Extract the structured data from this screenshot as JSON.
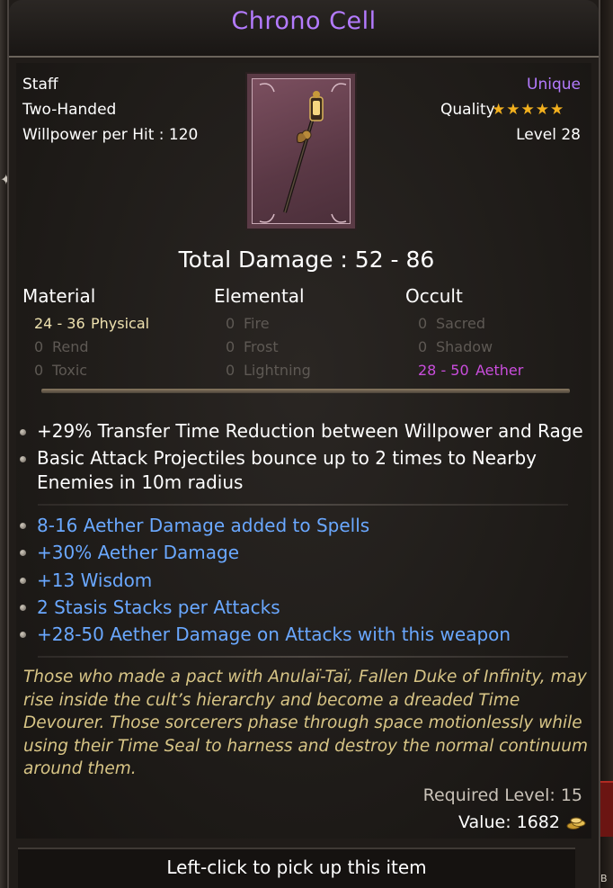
{
  "item": {
    "name": "Chrono Cell",
    "type": "Staff",
    "handedness": "Two-Handed",
    "willpower_per_hit": "Willpower per Hit : 120",
    "rarity": "Unique",
    "quality_label": "Quality",
    "quality_stars": 5,
    "level": "Level 28"
  },
  "damage": {
    "total": "Total Damage : 52 - 86",
    "columns": {
      "material": "Material",
      "elemental": "Elemental",
      "occult": "Occult"
    },
    "material": [
      {
        "value": "24 - 36",
        "label": "Physical"
      },
      {
        "value": "0",
        "label": "Rend"
      },
      {
        "value": "0",
        "label": "Toxic"
      }
    ],
    "elemental": [
      {
        "value": "0",
        "label": "Fire"
      },
      {
        "value": "0",
        "label": "Frost"
      },
      {
        "value": "0",
        "label": "Lightning"
      }
    ],
    "occult": [
      {
        "value": "0",
        "label": "Sacred"
      },
      {
        "value": "0",
        "label": "Shadow"
      },
      {
        "value": "28 - 50",
        "label": "Aether"
      }
    ]
  },
  "implicit_affixes": [
    "+29% Transfer Time Reduction between Willpower and Rage",
    "Basic Attack Projectiles bounce up to 2 times to Nearby",
    "Enemies in 10m radius"
  ],
  "affixes": [
    "8-16 Aether Damage added to Spells",
    "+30% Aether Damage",
    "+13 Wisdom",
    "2 Stasis Stacks per Attacks",
    "+28-50 Aether Damage on Attacks with this weapon"
  ],
  "lore": [
    "Those who made a pact with Anulaï-Taï, Fallen Duke of Infinity, may",
    "rise inside the cult’s hierarchy and become a dreaded Time",
    "Devourer. Those sorcerers phase through space motionlessly while",
    "using their Time Seal to harness and destroy the normal continuum",
    "around them."
  ],
  "required_level": "Required Level: 15",
  "value": "Value: 1682",
  "footer": "Left-click to pick up this item",
  "side_tag": "B",
  "colors": {
    "title": "#b47bff",
    "rarity": "#b47bff",
    "affix_blue": "#6aa8ff",
    "aether": "#c94ddc",
    "lore": "#d8c586",
    "stars": "#f2b01e"
  },
  "icons": [
    "star-icon",
    "bullet-icon",
    "gold-coins-icon",
    "staff-portrait"
  ]
}
